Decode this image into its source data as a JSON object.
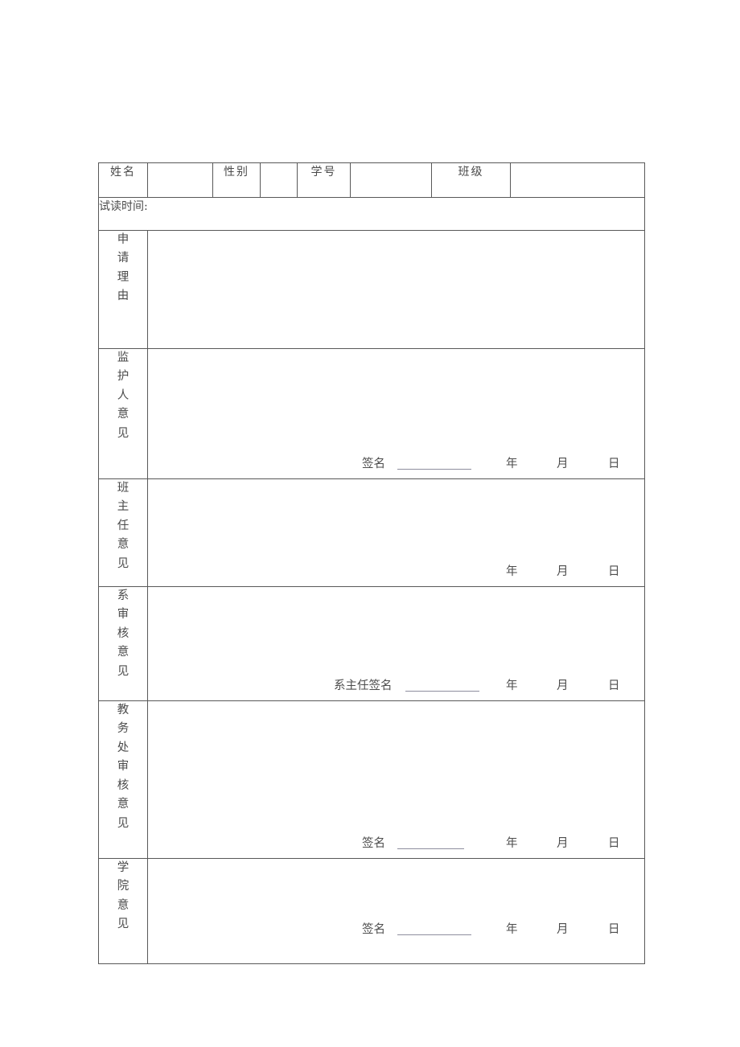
{
  "document": {
    "type": "form",
    "language": "zh-CN",
    "title_visible": false
  },
  "header_row": {
    "name_label": "姓名",
    "name_value": "",
    "gender_label": "性别",
    "gender_value": "",
    "student_id_label": "学号",
    "student_id_value": "",
    "class_label": "班级",
    "class_value": ""
  },
  "period_row": {
    "label": "试读时间:",
    "value": ""
  },
  "sections": [
    {
      "key": "reason",
      "label": "申请理由",
      "content": "",
      "signature_label": "",
      "has_signature_rule": false,
      "year": "",
      "month": "",
      "day": ""
    },
    {
      "key": "guardian",
      "label": "监护人意见",
      "content": "",
      "signature_label": "签名",
      "has_signature_rule": true,
      "year": "年",
      "month": "月",
      "day": "日"
    },
    {
      "key": "class_teacher",
      "label": "班主任意见",
      "content": "",
      "signature_label": "",
      "has_signature_rule": false,
      "year": "年",
      "month": "月",
      "day": "日"
    },
    {
      "key": "department",
      "label": "系审核意见",
      "content": "",
      "signature_label": "系主任签名",
      "has_signature_rule": true,
      "year": "年",
      "month": "月",
      "day": "日"
    },
    {
      "key": "academic_affairs",
      "label": "教务处审核意见",
      "content": "",
      "signature_label": "签名",
      "has_signature_rule": true,
      "year": "年",
      "month": "月",
      "day": "日"
    },
    {
      "key": "college",
      "label": "学院意见",
      "content": "",
      "signature_label": "签名",
      "has_signature_rule": true,
      "year": "年",
      "month": "月",
      "day": "日"
    }
  ],
  "colors": {
    "border": "#585858",
    "text": "#4b4b4b",
    "rule": "#8e8e9e",
    "background": "#ffffff"
  }
}
